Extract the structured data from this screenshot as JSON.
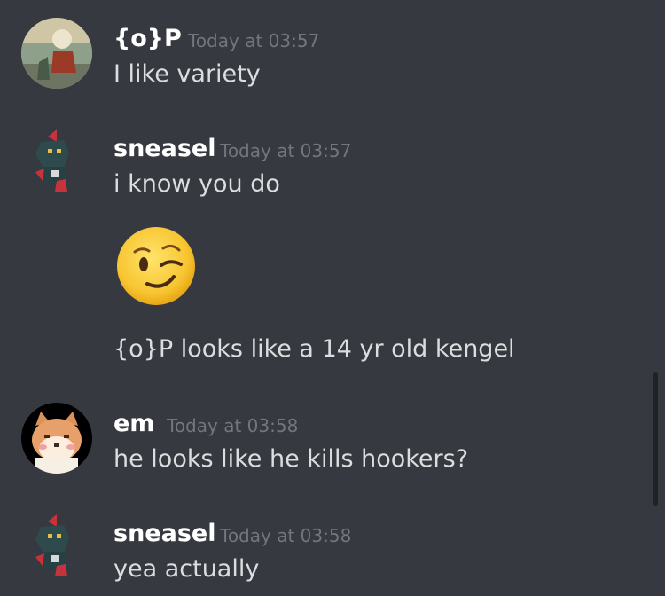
{
  "messages": [
    {
      "username": "{o}P",
      "timestamp": "Today at 03:57",
      "text": "I like variety",
      "avatar": "album-cover-avatar"
    },
    {
      "username": "sneasel",
      "timestamp": "Today at 03:57",
      "lines": [
        "i know you do",
        "{o}P looks like a 14 yr old kengel"
      ],
      "emoji": "winking-face-emoji",
      "avatar": "sneasel-pixel-avatar"
    },
    {
      "username": "em",
      "timestamp": "Today at 03:58",
      "text": "he looks like he kills hookers?",
      "avatar": "shiba-dog-avatar"
    },
    {
      "username": "sneasel",
      "timestamp": "Today at 03:58",
      "text": "yea actually",
      "avatar": "sneasel-pixel-avatar"
    }
  ],
  "colors": {
    "background": "#36393f",
    "username": "#ffffff",
    "timestamp": "#72767d",
    "text": "#dcddde"
  }
}
